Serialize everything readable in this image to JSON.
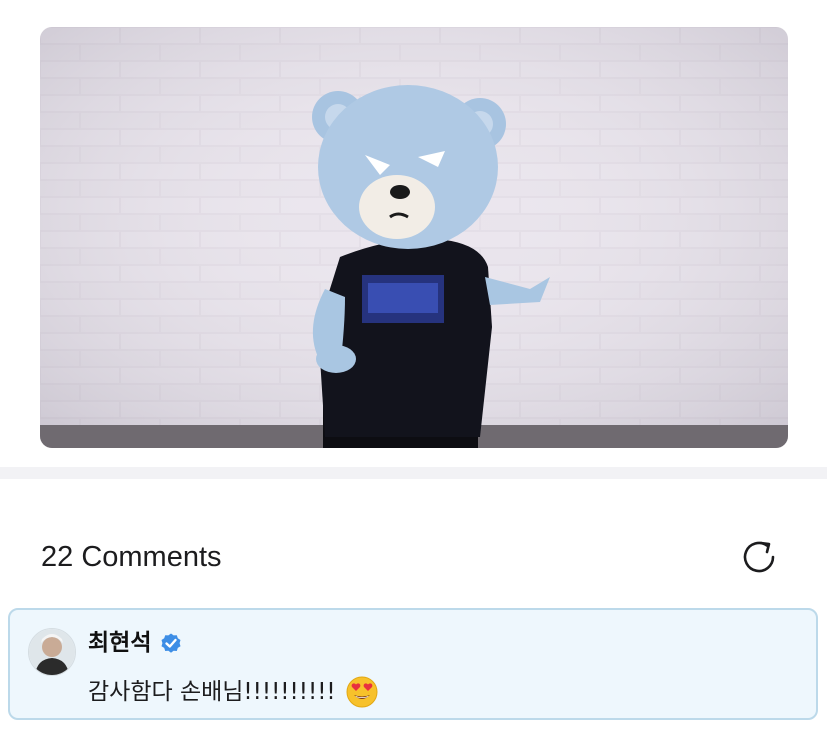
{
  "media": {
    "icon": "mascot-photo"
  },
  "comments": {
    "count_label": "22 Comments",
    "refresh_icon": "refresh-icon",
    "items": [
      {
        "author": "최현석",
        "verified": true,
        "text": "감사함다 손배님!!!!!!!!!!",
        "emoji": "heart-eyes-emoji",
        "highlight_color": "#eef7fd",
        "border_color": "#bcd9ea"
      }
    ]
  },
  "colors": {
    "verified_badge": "#3d8ee6",
    "divider": "#f2f2f5"
  }
}
